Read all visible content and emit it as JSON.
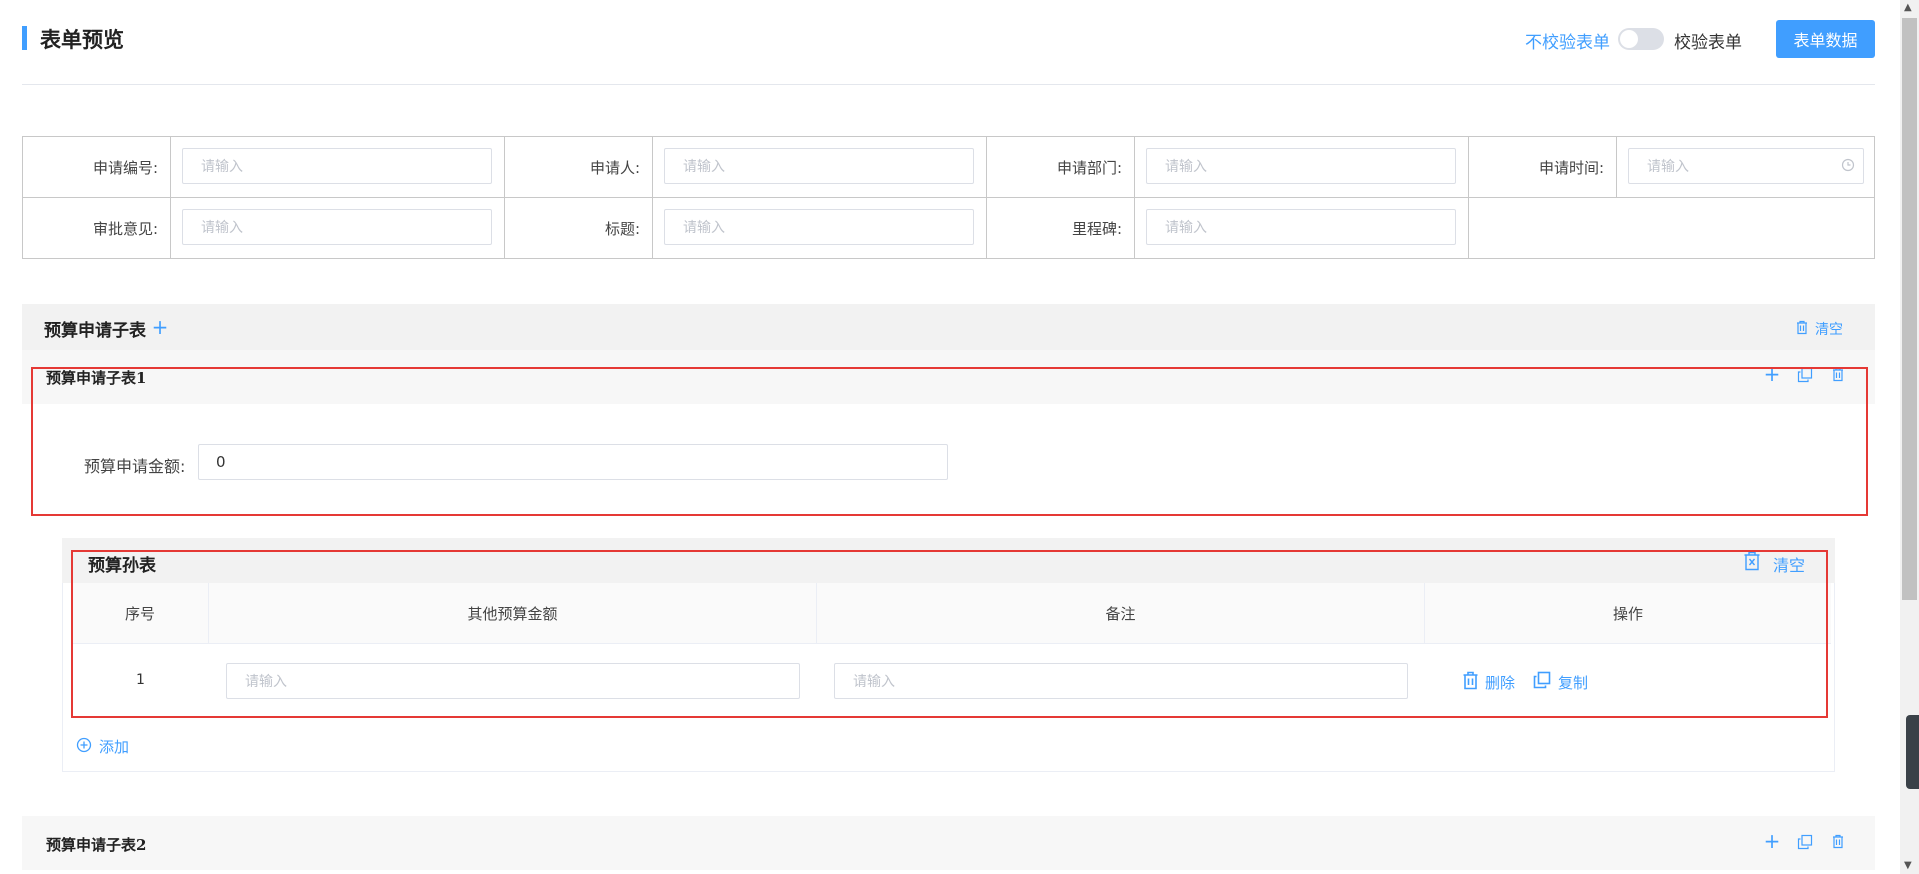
{
  "header": {
    "title": "表单预览",
    "toggle_off_label": "不校验表单",
    "toggle_on_label": "校验表单",
    "form_data_button": "表单数据",
    "accent_color": "#409eff"
  },
  "main_form": {
    "rows": [
      [
        {
          "label": "申请编号:",
          "placeholder": "请输入"
        },
        {
          "label": "申请人:",
          "placeholder": "请输入"
        },
        {
          "label": "申请部门:",
          "placeholder": "请输入"
        },
        {
          "label": "申请时间:",
          "placeholder": "请输入",
          "icon": "clock-icon"
        }
      ],
      [
        {
          "label": "审批意见:",
          "placeholder": "请输入"
        },
        {
          "label": "标题:",
          "placeholder": "请输入"
        },
        {
          "label": "里程碑:",
          "placeholder": "请输入"
        }
      ]
    ]
  },
  "budget_subtable": {
    "title": "预算申请子表",
    "add_icon": "plus-icon",
    "clear_label": "清空",
    "items": [
      {
        "title": "预算申请子表1",
        "field_label": "预算申请金额:",
        "field_value": "0"
      },
      {
        "title": "预算申请子表2"
      }
    ]
  },
  "grand_table": {
    "title": "预算孙表",
    "clear_label": "清空",
    "columns": [
      "序号",
      "其他预算金额",
      "备注",
      "操作"
    ],
    "rows": [
      {
        "index": "1",
        "amount_placeholder": "请输入",
        "note_placeholder": "请输入"
      }
    ],
    "delete_label": "删除",
    "copy_label": "复制",
    "add_label": "添加"
  },
  "annotation_color": "#e53935"
}
